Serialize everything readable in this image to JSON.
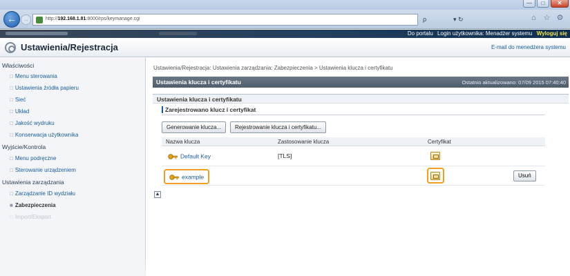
{
  "browser": {
    "url_prefix": "http://",
    "url_host": "192.168.1.81",
    "url_path": ":8000/rps/keymanage.cgi",
    "search_symbol": "ρ",
    "refresh_symbol": "▾ ↻",
    "back_symbol": "←",
    "forward_symbol": "→",
    "window_minimize": "—",
    "window_maximize": "□",
    "window_close": "✕"
  },
  "app_bar": {
    "portal_link": "Do portalu",
    "login_user": "Login użytkownika: Menadżer systemu",
    "logout": "Wyloguj się"
  },
  "header": {
    "title": "Ustawienia/Rejestracja",
    "email_link": "E-mail do menedżera systemu"
  },
  "sidebar": {
    "sections": [
      {
        "label": "Właściwości",
        "items": [
          "Menu sterowania",
          "Ustawienia źródła papieru",
          "Sieć",
          "Układ",
          "Jakość wydruku",
          "Konserwacja użytkownika"
        ]
      },
      {
        "label": "Wyjście/Kontrola",
        "items": [
          "Menu podręczne",
          "Sterowanie urządzeniem"
        ]
      },
      {
        "label": "Ustawienia zarządzania",
        "items": [
          "Zarządzanie ID wydziału",
          "Zabezpieczenia",
          "Import/Eksport"
        ]
      }
    ]
  },
  "main": {
    "breadcrumb": "Ustawienia/Rejestracja: Ustawienia zarządzania: Zabezpieczenia > Ustawienia klucza i certyfikatu",
    "page_title": "Ustawienia klucza i certyfikatu",
    "last_updated": "Ostatnio aktualizowano: 07/09 2015 07:40:40",
    "section_title": "Ustawienia klucza i certyfikatu",
    "registered_label": "Zarejestrowano klucz i certyfikat",
    "buttons": {
      "generate": "Generowanie klucza...",
      "register": "Rejestrowanie klucza i certyfikatu..."
    },
    "columns": [
      "Nazwa klucza",
      "Zastosowanie klucza",
      "Certyfikat"
    ],
    "rows": [
      {
        "name": "Default Key",
        "usage": "[TLS]",
        "delete": ""
      },
      {
        "name": "example",
        "usage": "",
        "delete": "Usuń"
      }
    ],
    "top_arrow": "▲"
  }
}
